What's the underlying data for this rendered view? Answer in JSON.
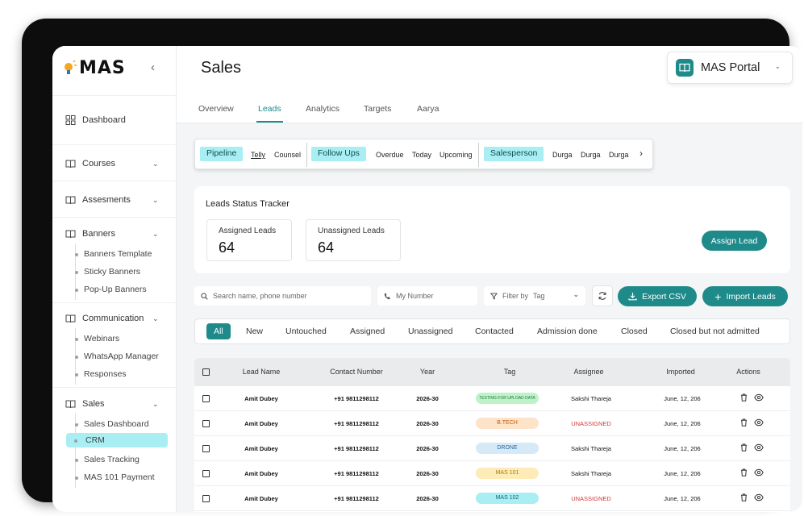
{
  "app": {
    "logo": "MAS",
    "title": "Sales",
    "portal": "MAS Portal"
  },
  "sidebar": {
    "dashboard": "Dashboard",
    "courses": "Courses",
    "assesments": "Assesments",
    "banners": "Banners",
    "banners_sub": [
      "Banners Template",
      "Sticky Banners",
      "Pop-Up Banners"
    ],
    "communication": "Communication",
    "communication_sub": [
      "Webinars",
      "WhatsApp Manager",
      "Responses"
    ],
    "sales": "Sales",
    "sales_sub": [
      "Sales Dashboard",
      "CRM",
      "Sales Tracking",
      "MAS 101 Payment"
    ],
    "active_item": "CRM"
  },
  "tabs": [
    "Overview",
    "Leads",
    "Analytics",
    "Targets",
    "Aarya"
  ],
  "active_tab": "Leads",
  "filters": {
    "pipeline": "Pipeline",
    "pipeline_items": [
      "Telly",
      "Counsel"
    ],
    "followups": "Follow Ups",
    "followup_items": [
      "Overdue",
      "Today",
      "Upcoming"
    ],
    "salesperson": "Salesperson",
    "salesperson_items": [
      "Durga",
      "Durga",
      "Durga"
    ]
  },
  "tracker": {
    "title": "Leads Status Tracker",
    "assigned_label": "Assigned Leads",
    "assigned_value": "64",
    "unassigned_label": "Unassigned Leads",
    "unassigned_value": "64",
    "assign_button": "Assign Lead"
  },
  "toolbar": {
    "search_placeholder": "Search name, phone number",
    "number_placeholder": "My Number",
    "filter_label": "Filter by",
    "filter_value": "Tag",
    "export": "Export CSV",
    "import": "Import Leads"
  },
  "status_tabs": [
    "All",
    "New",
    "Untouched",
    "Assigned",
    "Unassigned",
    "Contacted",
    "Admission done",
    "Closed",
    "Closed but not admitted"
  ],
  "active_status": "All",
  "table": {
    "headers": [
      "Lead Name",
      "Contact Number",
      "Year",
      "Tag",
      "Assignee",
      "Imported",
      "Actions"
    ],
    "rows": [
      {
        "name": "Amit Dubey",
        "contact": "+91 9811298112",
        "year": "2026-30",
        "tag": "TESTING FOR UPLOAD DATA",
        "assignee": "Sakshi Thareja",
        "imported": "June, 12, 206"
      },
      {
        "name": "Amit Dubey",
        "contact": "+91 9811298112",
        "year": "2026-30",
        "tag": "B.TECH",
        "assignee": "UNASSIGNED",
        "imported": "June, 12, 206"
      },
      {
        "name": "Amit Dubey",
        "contact": "+91 9811298112",
        "year": "2026-30",
        "tag": "DRONE",
        "assignee": "Sakshi Thareja",
        "imported": "June, 12, 206"
      },
      {
        "name": "Amit Dubey",
        "contact": "+91 9811298112",
        "year": "2026-30",
        "tag": "MAS 101",
        "assignee": "Sakshi Thareja",
        "imported": "June, 12, 206"
      },
      {
        "name": "Amit Dubey",
        "contact": "+91 9811298112",
        "year": "2026-30",
        "tag": "MAS 102",
        "assignee": "UNASSIGNED",
        "imported": "June, 12, 206"
      }
    ]
  },
  "colors": {
    "accent": "#1f8a8a",
    "highlight": "#a8eef3",
    "unassigned": "#d63a3a",
    "tag_testing_bg": "#bff2c9",
    "tag_btech_bg": "#fde3c8",
    "tag_drone_bg": "#d6e9f7",
    "tag_mas101_bg": "#fdecb8",
    "tag_mas102_bg": "#a8eef3"
  }
}
